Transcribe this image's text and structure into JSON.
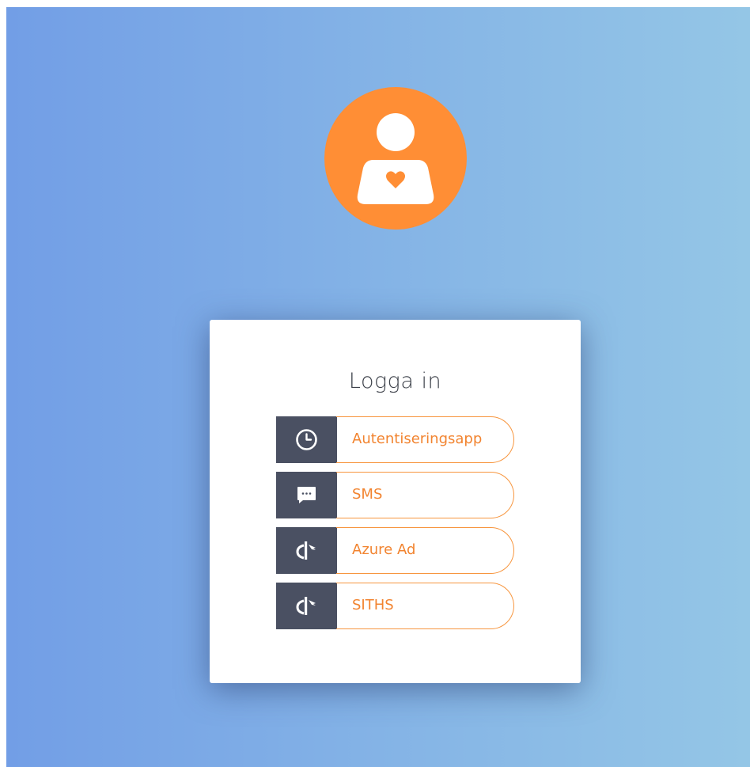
{
  "brand": {
    "logo_icon": "person-heart-icon",
    "accent_color": "#ff8e35"
  },
  "login": {
    "title": "Logga in",
    "methods": [
      {
        "label": "Autentiseringsapp",
        "icon": "clock-icon"
      },
      {
        "label": "SMS",
        "icon": "sms-chat-icon"
      },
      {
        "label": "Azure Ad",
        "icon": "openid-icon"
      },
      {
        "label": "SITHS",
        "icon": "openid-icon"
      }
    ]
  },
  "colors": {
    "icon_background": "#4a5062",
    "button_border": "#f7963f",
    "button_text": "#f28430"
  }
}
